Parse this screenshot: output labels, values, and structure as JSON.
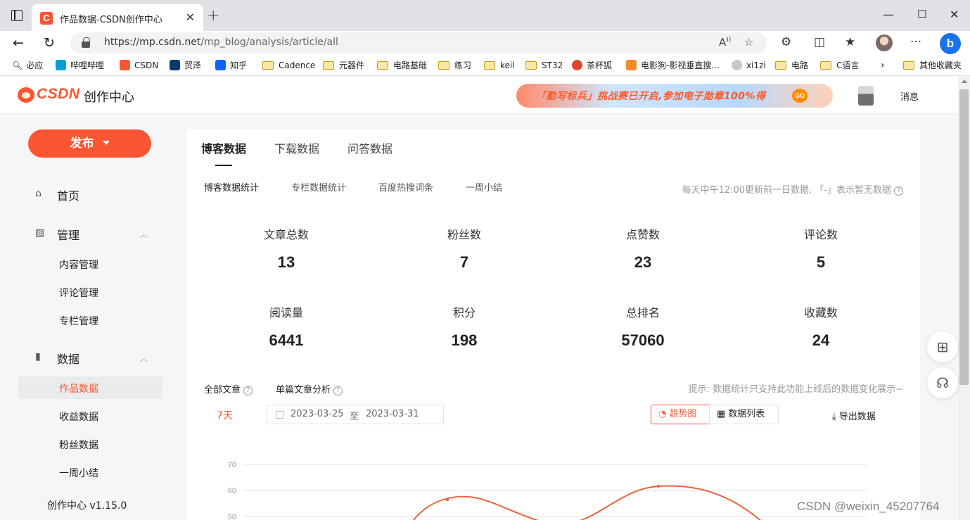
{
  "browser": {
    "tab_title": "作品数据-CSDN创作中心",
    "tab_favicon": "C",
    "url_host": "https://mp.csdn.net",
    "url_path": "/mp_blog/analysis/article/all",
    "bookmarks": [
      "必应",
      "哔哩哔哩",
      "CSDN",
      "贸泽",
      "知乎",
      "Cadence",
      "元器件",
      "电路基础",
      "练习",
      "keil",
      "ST32",
      "茶杯狐",
      "电影狗-影视垂直搜...",
      "xi1zi",
      "电路",
      "C语言"
    ],
    "other_bookmarks": "其他收藏夹"
  },
  "header": {
    "logo": "CSDN",
    "title": "创作中心",
    "banner": "「勤写标兵」挑战赛已开启,参加电子勋章100%得",
    "banner_go": "GO",
    "messages": "消息"
  },
  "sidebar": {
    "publish": "发布",
    "home": "首页",
    "manage": "管理",
    "content_manage": "内容管理",
    "comment_manage": "评论管理",
    "column_manage": "专栏管理",
    "data": "数据",
    "works_data": "作品数据",
    "income_data": "收益数据",
    "fans_data": "粉丝数据",
    "weekly_summary": "一周小结",
    "version": "创作中心 v1.15.0"
  },
  "main": {
    "tabs": [
      "博客数据",
      "下载数据",
      "问答数据"
    ],
    "subtabs": [
      "博客数据统计",
      "专栏数据统计",
      "百度热搜词条",
      "一周小结"
    ],
    "update_note": "每天中午12:00更新前一日数据, 「-」表示暂无数据",
    "stats": [
      {
        "label": "文章总数",
        "value": "13"
      },
      {
        "label": "粉丝数",
        "value": "7"
      },
      {
        "label": "点赞数",
        "value": "23"
      },
      {
        "label": "评论数",
        "value": "5"
      },
      {
        "label": "阅读量",
        "value": "6441"
      },
      {
        "label": "积分",
        "value": "198"
      },
      {
        "label": "总排名",
        "value": "57060"
      },
      {
        "label": "收藏数",
        "value": "24"
      }
    ],
    "all_articles": "全部文章",
    "single_analysis": "单篇文章分析",
    "hint": "提示: 数据统计只支持此功能上线后的数据变化展示~",
    "days": "7天",
    "date_start": "2023-03-25",
    "date_sep": "至",
    "date_end": "2023-03-31",
    "trend_btn": "趋势图",
    "list_btn": "数据列表",
    "export": "导出数据"
  },
  "chart_data": {
    "type": "line",
    "yticks": [
      "70",
      "60",
      "50"
    ],
    "ylim": [
      50,
      70
    ],
    "series_color": "#e8643c"
  },
  "watermark": "CSDN @weixin_45207764"
}
